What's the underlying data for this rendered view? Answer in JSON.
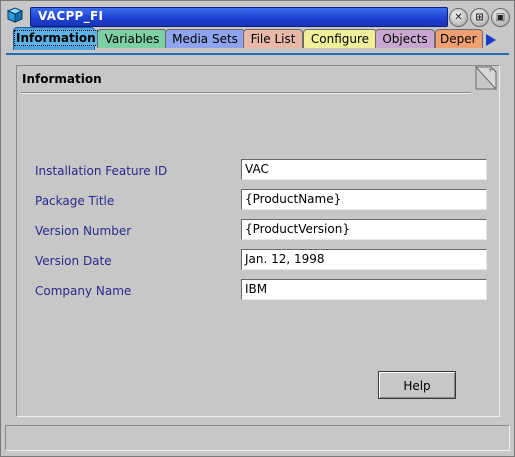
{
  "window": {
    "title": "VACPP_FI",
    "controls": [
      "close-icon",
      "maximize-icon",
      "restore-icon"
    ]
  },
  "tabs": [
    {
      "label": "Information",
      "color": "#4aa6e0",
      "active": true
    },
    {
      "label": "Variables",
      "color": "#7cd0a4",
      "active": false
    },
    {
      "label": "Media Sets",
      "color": "#8fa4ee",
      "active": false
    },
    {
      "label": "File List",
      "color": "#e8b8a8",
      "active": false
    },
    {
      "label": "Configure",
      "color": "#f2ef9a",
      "active": false
    },
    {
      "label": "Objects",
      "color": "#c8a8d0",
      "active": false
    },
    {
      "label": "Deper",
      "color": "#f0a070",
      "active": false
    }
  ],
  "panel": {
    "heading": "Information",
    "fields": [
      {
        "label": "Installation Feature ID",
        "value": "VAC"
      },
      {
        "label": "Package Title",
        "value": "{ProductName}"
      },
      {
        "label": "Version Number",
        "value": "{ProductVersion}"
      },
      {
        "label": "Version Date",
        "value": "Jan. 12, 1998"
      },
      {
        "label": "Company Name",
        "value": "IBM"
      }
    ],
    "help_label": "Help"
  }
}
